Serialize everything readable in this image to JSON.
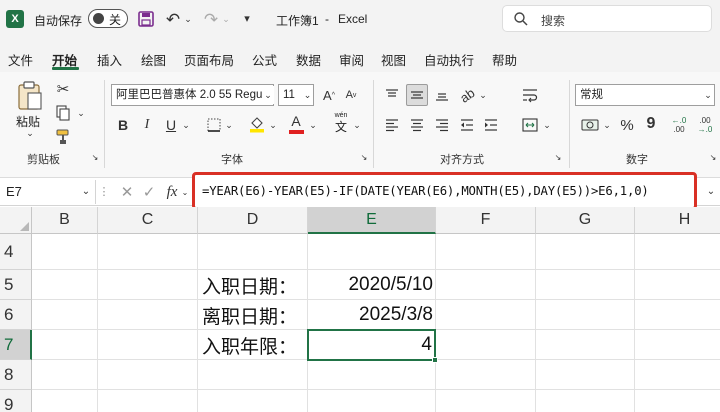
{
  "titlebar": {
    "autosave_label": "自动保存",
    "autosave_state": "关",
    "doc_title": "工作簿1",
    "separator": "-",
    "app_name": "Excel",
    "search_placeholder": "搜索"
  },
  "menu_tabs": [
    "文件",
    "开始",
    "插入",
    "绘图",
    "页面布局",
    "公式",
    "数据",
    "审阅",
    "视图",
    "自动执行",
    "帮助"
  ],
  "active_tab_index": 1,
  "ribbon": {
    "paste_label": "粘贴",
    "clipboard_group": "剪贴板",
    "font_name": "阿里巴巴普惠体 2.0 55 Regu",
    "font_size": "11",
    "bold": "B",
    "italic": "I",
    "underline": "U",
    "font_color_letter": "A",
    "phonetic_top": "wén",
    "phonetic_bottom": "文",
    "font_group": "字体",
    "align_group": "对齐方式",
    "number_format": "常规",
    "number_group": "数字",
    "percent": "%",
    "comma": "9"
  },
  "formula_bar": {
    "name_box": "E7",
    "fx": "fx",
    "formula": "=YEAR(E6)-YEAR(E5)-IF(DATE(YEAR(E6),MONTH(E5),DAY(E5))>E6,1,0)"
  },
  "grid": {
    "columns": [
      "B",
      "C",
      "D",
      "E",
      "F",
      "G",
      "H"
    ],
    "rows": [
      "4",
      "5",
      "6",
      "7",
      "8",
      "9"
    ],
    "cells": {
      "D5": "入职日期：",
      "E5": "2020/5/10",
      "D6": "离职日期：",
      "E6": "2025/3/8",
      "D7": "入职年限：",
      "E7": "4"
    },
    "selected_cell": "E7"
  },
  "colors": {
    "excel_green": "#217346",
    "highlight_red": "#d93025",
    "save_purple": "#7b2d8e",
    "fill_yellow": "#ffe600",
    "font_red": "#e02020"
  }
}
